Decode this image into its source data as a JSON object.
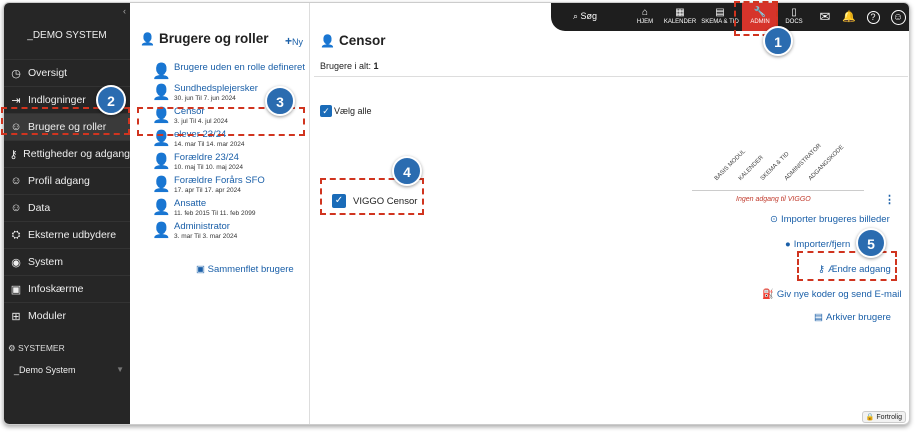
{
  "sidebar": {
    "system_name": "_DEMO SYSTEM",
    "items": [
      {
        "label": "Oversigt",
        "icon": "dashboard-icon",
        "glyph": "◷"
      },
      {
        "label": "Indlogninger",
        "icon": "login-icon",
        "glyph": "⇥"
      },
      {
        "label": "Brugere og roller",
        "icon": "users-icon",
        "glyph": "☺"
      },
      {
        "label": "Rettigheder og adgang",
        "icon": "key-icon",
        "glyph": "⚷"
      },
      {
        "label": "Profil adgang",
        "icon": "profile-icon",
        "glyph": "☺"
      },
      {
        "label": "Data",
        "icon": "data-icon",
        "glyph": "☺"
      },
      {
        "label": "Eksterne udbydere",
        "icon": "external-icon",
        "glyph": "⛭"
      },
      {
        "label": "System",
        "icon": "system-icon",
        "glyph": "◉"
      },
      {
        "label": "Infoskærme",
        "icon": "screen-icon",
        "glyph": "▣"
      },
      {
        "label": "Moduler",
        "icon": "modules-icon",
        "glyph": "⊞"
      }
    ],
    "systems_heading": "SYSTEMER",
    "systems_selected": "_Demo System"
  },
  "middle": {
    "title": "Brugere og roller",
    "add_label": "Ny",
    "users": [
      {
        "title": "Brugere uden en rolle defineret",
        "date": "",
        "color": "#ffffff"
      },
      {
        "title": "Sundhedsplejersker",
        "date": "30. jun Til 7. jun 2024",
        "color": "#1a5fa8"
      },
      {
        "title": "Censor",
        "date": "3. jul Til 4. jul 2024",
        "color": "#1a5fa8"
      },
      {
        "title": "elever 23/24",
        "date": "14. mar Til 14. mar 2024",
        "color": "#1a5fa8"
      },
      {
        "title": "Forældre 23/24",
        "date": "10. maj Til 10. maj 2024",
        "color": "#1a5fa8"
      },
      {
        "title": "Forældre Forårs SFO",
        "date": "17. apr Til 17. apr 2024",
        "color": "#1a5fa8"
      },
      {
        "title": "Ansatte",
        "date": "11. feb 2015 Til 11. feb 2099",
        "color": "#1a3fc8"
      },
      {
        "title": "Administrator",
        "date": "3. mar Til 3. mar 2024",
        "color": "#f2d77a"
      }
    ],
    "merge_label": "Sammenflet brugere"
  },
  "topbar": {
    "search_label": "Søg",
    "buttons": [
      {
        "label": "HJEM",
        "icon": "home-icon",
        "glyph": "⌂"
      },
      {
        "label": "KALENDER",
        "icon": "calendar-icon",
        "glyph": "▦"
      },
      {
        "label": "SKEMA & TID",
        "icon": "schedule-icon",
        "glyph": "▤"
      },
      {
        "label": "ADMIN",
        "icon": "wrench-icon",
        "glyph": "🔧"
      },
      {
        "label": "DOCS",
        "icon": "docs-icon",
        "glyph": "▯"
      }
    ],
    "icons": [
      {
        "name": "mail-icon",
        "glyph": "✉"
      },
      {
        "name": "bell-icon",
        "glyph": "🔔"
      },
      {
        "name": "help-icon",
        "glyph": "?"
      },
      {
        "name": "avatar-icon",
        "glyph": "☺"
      }
    ]
  },
  "main": {
    "title": "Censor",
    "count_label": "Brugere i alt:",
    "count_value": "1",
    "select_all": "Vælg alle",
    "role_name": "VIGGO Censor",
    "columns": [
      "BASIS MODUL",
      "KALENDER",
      "SKEMA & TID",
      "ADMINISTRATOR",
      "ADGANGSKODE"
    ],
    "no_access": "Ingen adgang til VIGGO",
    "actions": [
      "Importer brugeres billeder",
      "Importer/fjern",
      "Ændre adgang",
      "Giv nye koder og send E-mail",
      "Arkiver brugere"
    ],
    "readonly": "Fortrolig"
  },
  "annotations": [
    "1",
    "2",
    "3",
    "4",
    "5"
  ],
  "colors": {
    "accent": "#1a5fa8",
    "admin_red": "#d6342b",
    "annotation": "#d0341f",
    "badge": "#2b6cb0"
  }
}
